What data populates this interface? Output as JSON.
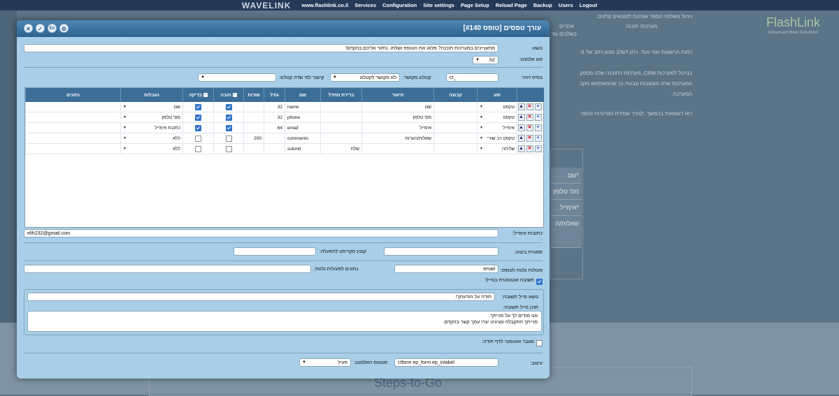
{
  "topbar": {
    "brand": "WAVELINK",
    "nav": [
      "www.flashlink.co.il",
      "Services",
      "Configuration",
      "Site settings",
      "Page Setup",
      "Reload Page",
      "Backup",
      "Users",
      "Logout"
    ]
  },
  "background": {
    "logo": "FlashLink",
    "logo_sub": "Advanced Web Solutions",
    "menu_1": "מערכות תוכנה",
    "menu_2": "אתרים",
    "text_lines": [
      "ניהול משלוחי הספר אמינות למוצאים ונלווים",
      "בשלבים ומשלוח ככל קבלת",
      "רמות הרשאות ועוד ועוד. ניתן לשלב מגוון רחב של מ",
      "בניהול למערכות CRM, מערכות התוכנה שלנו מספק",
      "המערכות שלנו מעוצבות ונבנות כך שהמשתמש מקב",
      "המערכת.",
      "ראו דוגמאות בהמשך. לצורך שמירת הפרטיות והסוד"
    ],
    "form_fields": [
      "שם*",
      "מס' טלפון",
      "אימייל*",
      "שאלות/ה"
    ],
    "steps": "Steps-to-Go"
  },
  "dialog": {
    "title": "עורך טפסים [טופס #140]",
    "header_buttons": [
      "close",
      "save",
      "en",
      "settings"
    ],
    "header_buttons_text": {
      "close": "✕",
      "save": "✓",
      "en": "En",
      "settings": "⚙"
    },
    "subject_label": "נושא:",
    "subject_value": "מתעניינים במערכות תוכנה? מלאו את הטופס ושלחו. נחזור אליכם בהקדם!",
    "element_type_label": "סוג אלמנט:",
    "element_type_value": "h2",
    "id_base_label": "בסיס זיהוי:",
    "id_base_value": "ct_",
    "catalog_label": "קטלוג מקושר:",
    "catalog_value": "לא מקושר לקטלוג",
    "catalog_field_label": "קישור לפי שדה קטלוג:",
    "catalog_field_value": "",
    "grid": {
      "columns": [
        "",
        "סוג",
        "קבוצה",
        "תיאור",
        "ברירת מחדל",
        "שם",
        "גודל",
        "שורות",
        "חובה",
        "בדיקה",
        "הגבלות",
        "נתונים"
      ],
      "rows": [
        {
          "type": "טקסט",
          "group": "",
          "desc": "שם",
          "default": "",
          "name": "name",
          "size": "32",
          "rows": "",
          "required": true,
          "check": true,
          "limits": "שם",
          "data": ""
        },
        {
          "type": "טקסט",
          "group": "",
          "desc": "מס' טלפון",
          "default": "",
          "name": "phone",
          "size": "32",
          "rows": "",
          "required": true,
          "check": true,
          "limits": "מס' טלפון",
          "data": ""
        },
        {
          "type": "אימייל",
          "group": "",
          "desc": "אימייל",
          "default": "",
          "name": "email",
          "size": "64",
          "rows": "",
          "required": true,
          "check": true,
          "limits": "כתובת אימייל",
          "data": ""
        },
        {
          "type": "טקסט רב שורי",
          "group": "",
          "desc": "שאלות/הערות",
          "default": "",
          "name": "comments",
          "size": "",
          "rows": "200",
          "required": false,
          "check": false,
          "limits": "ללא",
          "data": ""
        },
        {
          "type": "שליחה",
          "group": "",
          "desc": "",
          "default": "שלח",
          "name": "submit",
          "size": "",
          "rows": "",
          "required": false,
          "check": false,
          "limits": "ללא",
          "data": ""
        }
      ]
    },
    "email_label": "כתובות אימייל:",
    "email_value": "elih232@gmail.com",
    "layout_label": "מסגרת ביצוע:",
    "layout_value": "",
    "script_label": "קובץ סקריפט להפעלה:",
    "script_value": "",
    "actions_label": "פעולות נלוות לטופס:",
    "actions_value": "email",
    "actions_data_label": "נתונים לפעולות נלוות:",
    "actions_data_value": "",
    "auto_reply_label": "תשובה אוטומטית במייל:",
    "auto_reply_checked": true,
    "reply_subject_label": "נושא מייל תשובה:",
    "reply_subject_value": "תודה על הודעתך!",
    "reply_body_label": "תוכן מייל תשובה:",
    "reply_body_line1": "אנו מודים לך על פנייתך.",
    "reply_body_line2": "פנייתך התקבלה ונציגינו יצרו עמך קשר בהקדם.",
    "auto_redirect_label": "מעבר אוטומטי לדף תודה:",
    "auto_redirect_checked": false,
    "style_label": "עיצוב:",
    "style_value": "ctform ep_form ep_inlabel",
    "status_label": "סטטוס האלמנט:",
    "status_value": "פעיל"
  }
}
